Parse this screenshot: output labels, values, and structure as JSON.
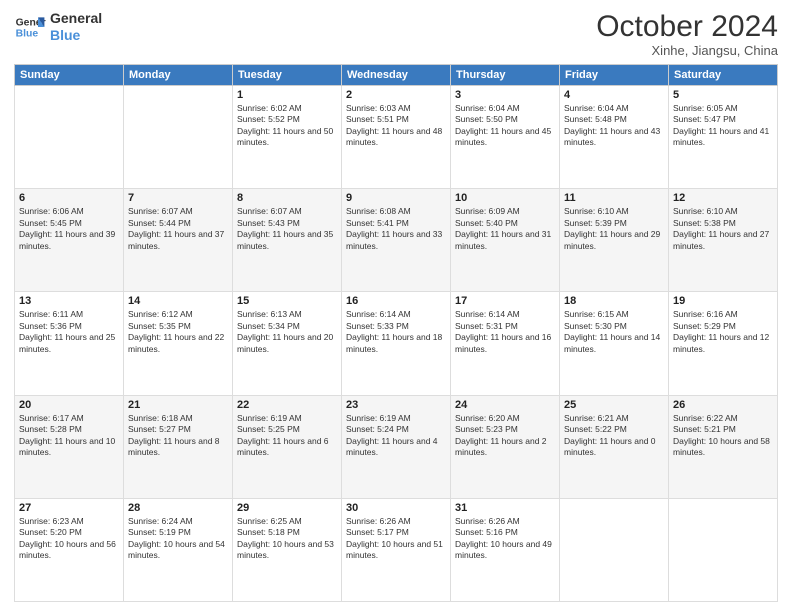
{
  "header": {
    "logo_line1": "General",
    "logo_line2": "Blue",
    "month": "October 2024",
    "location": "Xinhe, Jiangsu, China"
  },
  "weekdays": [
    "Sunday",
    "Monday",
    "Tuesday",
    "Wednesday",
    "Thursday",
    "Friday",
    "Saturday"
  ],
  "weeks": [
    [
      {
        "day": "",
        "sunrise": "",
        "sunset": "",
        "daylight": ""
      },
      {
        "day": "",
        "sunrise": "",
        "sunset": "",
        "daylight": ""
      },
      {
        "day": "1",
        "sunrise": "Sunrise: 6:02 AM",
        "sunset": "Sunset: 5:52 PM",
        "daylight": "Daylight: 11 hours and 50 minutes."
      },
      {
        "day": "2",
        "sunrise": "Sunrise: 6:03 AM",
        "sunset": "Sunset: 5:51 PM",
        "daylight": "Daylight: 11 hours and 48 minutes."
      },
      {
        "day": "3",
        "sunrise": "Sunrise: 6:04 AM",
        "sunset": "Sunset: 5:50 PM",
        "daylight": "Daylight: 11 hours and 45 minutes."
      },
      {
        "day": "4",
        "sunrise": "Sunrise: 6:04 AM",
        "sunset": "Sunset: 5:48 PM",
        "daylight": "Daylight: 11 hours and 43 minutes."
      },
      {
        "day": "5",
        "sunrise": "Sunrise: 6:05 AM",
        "sunset": "Sunset: 5:47 PM",
        "daylight": "Daylight: 11 hours and 41 minutes."
      }
    ],
    [
      {
        "day": "6",
        "sunrise": "Sunrise: 6:06 AM",
        "sunset": "Sunset: 5:45 PM",
        "daylight": "Daylight: 11 hours and 39 minutes."
      },
      {
        "day": "7",
        "sunrise": "Sunrise: 6:07 AM",
        "sunset": "Sunset: 5:44 PM",
        "daylight": "Daylight: 11 hours and 37 minutes."
      },
      {
        "day": "8",
        "sunrise": "Sunrise: 6:07 AM",
        "sunset": "Sunset: 5:43 PM",
        "daylight": "Daylight: 11 hours and 35 minutes."
      },
      {
        "day": "9",
        "sunrise": "Sunrise: 6:08 AM",
        "sunset": "Sunset: 5:41 PM",
        "daylight": "Daylight: 11 hours and 33 minutes."
      },
      {
        "day": "10",
        "sunrise": "Sunrise: 6:09 AM",
        "sunset": "Sunset: 5:40 PM",
        "daylight": "Daylight: 11 hours and 31 minutes."
      },
      {
        "day": "11",
        "sunrise": "Sunrise: 6:10 AM",
        "sunset": "Sunset: 5:39 PM",
        "daylight": "Daylight: 11 hours and 29 minutes."
      },
      {
        "day": "12",
        "sunrise": "Sunrise: 6:10 AM",
        "sunset": "Sunset: 5:38 PM",
        "daylight": "Daylight: 11 hours and 27 minutes."
      }
    ],
    [
      {
        "day": "13",
        "sunrise": "Sunrise: 6:11 AM",
        "sunset": "Sunset: 5:36 PM",
        "daylight": "Daylight: 11 hours and 25 minutes."
      },
      {
        "day": "14",
        "sunrise": "Sunrise: 6:12 AM",
        "sunset": "Sunset: 5:35 PM",
        "daylight": "Daylight: 11 hours and 22 minutes."
      },
      {
        "day": "15",
        "sunrise": "Sunrise: 6:13 AM",
        "sunset": "Sunset: 5:34 PM",
        "daylight": "Daylight: 11 hours and 20 minutes."
      },
      {
        "day": "16",
        "sunrise": "Sunrise: 6:14 AM",
        "sunset": "Sunset: 5:33 PM",
        "daylight": "Daylight: 11 hours and 18 minutes."
      },
      {
        "day": "17",
        "sunrise": "Sunrise: 6:14 AM",
        "sunset": "Sunset: 5:31 PM",
        "daylight": "Daylight: 11 hours and 16 minutes."
      },
      {
        "day": "18",
        "sunrise": "Sunrise: 6:15 AM",
        "sunset": "Sunset: 5:30 PM",
        "daylight": "Daylight: 11 hours and 14 minutes."
      },
      {
        "day": "19",
        "sunrise": "Sunrise: 6:16 AM",
        "sunset": "Sunset: 5:29 PM",
        "daylight": "Daylight: 11 hours and 12 minutes."
      }
    ],
    [
      {
        "day": "20",
        "sunrise": "Sunrise: 6:17 AM",
        "sunset": "Sunset: 5:28 PM",
        "daylight": "Daylight: 11 hours and 10 minutes."
      },
      {
        "day": "21",
        "sunrise": "Sunrise: 6:18 AM",
        "sunset": "Sunset: 5:27 PM",
        "daylight": "Daylight: 11 hours and 8 minutes."
      },
      {
        "day": "22",
        "sunrise": "Sunrise: 6:19 AM",
        "sunset": "Sunset: 5:25 PM",
        "daylight": "Daylight: 11 hours and 6 minutes."
      },
      {
        "day": "23",
        "sunrise": "Sunrise: 6:19 AM",
        "sunset": "Sunset: 5:24 PM",
        "daylight": "Daylight: 11 hours and 4 minutes."
      },
      {
        "day": "24",
        "sunrise": "Sunrise: 6:20 AM",
        "sunset": "Sunset: 5:23 PM",
        "daylight": "Daylight: 11 hours and 2 minutes."
      },
      {
        "day": "25",
        "sunrise": "Sunrise: 6:21 AM",
        "sunset": "Sunset: 5:22 PM",
        "daylight": "Daylight: 11 hours and 0 minutes."
      },
      {
        "day": "26",
        "sunrise": "Sunrise: 6:22 AM",
        "sunset": "Sunset: 5:21 PM",
        "daylight": "Daylight: 10 hours and 58 minutes."
      }
    ],
    [
      {
        "day": "27",
        "sunrise": "Sunrise: 6:23 AM",
        "sunset": "Sunset: 5:20 PM",
        "daylight": "Daylight: 10 hours and 56 minutes."
      },
      {
        "day": "28",
        "sunrise": "Sunrise: 6:24 AM",
        "sunset": "Sunset: 5:19 PM",
        "daylight": "Daylight: 10 hours and 54 minutes."
      },
      {
        "day": "29",
        "sunrise": "Sunrise: 6:25 AM",
        "sunset": "Sunset: 5:18 PM",
        "daylight": "Daylight: 10 hours and 53 minutes."
      },
      {
        "day": "30",
        "sunrise": "Sunrise: 6:26 AM",
        "sunset": "Sunset: 5:17 PM",
        "daylight": "Daylight: 10 hours and 51 minutes."
      },
      {
        "day": "31",
        "sunrise": "Sunrise: 6:26 AM",
        "sunset": "Sunset: 5:16 PM",
        "daylight": "Daylight: 10 hours and 49 minutes."
      },
      {
        "day": "",
        "sunrise": "",
        "sunset": "",
        "daylight": ""
      },
      {
        "day": "",
        "sunrise": "",
        "sunset": "",
        "daylight": ""
      }
    ]
  ]
}
